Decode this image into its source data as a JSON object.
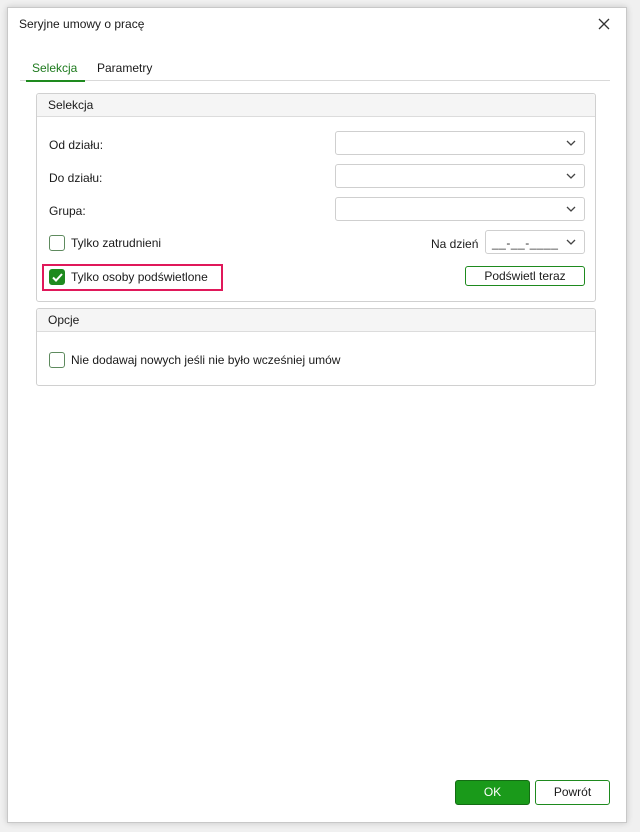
{
  "window": {
    "title": "Seryjne umowy o pracę"
  },
  "tabs": [
    {
      "label": "Selekcja",
      "active": true
    },
    {
      "label": "Parametry",
      "active": false
    }
  ],
  "selekcja": {
    "header": "Selekcja",
    "od_dzialu": {
      "label": "Od działu:",
      "value": ""
    },
    "do_dzialu": {
      "label": "Do działu:",
      "value": ""
    },
    "grupa": {
      "label": "Grupa:",
      "value": ""
    },
    "tylko_zatrudnieni": {
      "label": "Tylko zatrudnieni",
      "checked": false
    },
    "na_dzien": {
      "label": "Na dzień",
      "value": "__-__-____"
    },
    "tylko_podswietlone": {
      "label": "Tylko osoby podświetlone",
      "checked": true
    },
    "podswietl_button": "Podświetl teraz"
  },
  "opcje": {
    "header": "Opcje",
    "nie_dodawaj": {
      "label": "Nie dodawaj nowych jeśli nie było wcześniej umów",
      "checked": false
    }
  },
  "footer": {
    "ok": "OK",
    "cancel": "Powrót"
  },
  "colors": {
    "accent": "#1e8a1e",
    "highlight": "#e0185a"
  },
  "icons": {
    "close": "close-icon",
    "dropdown": "chevron-down-icon",
    "check": "checkmark-icon"
  }
}
